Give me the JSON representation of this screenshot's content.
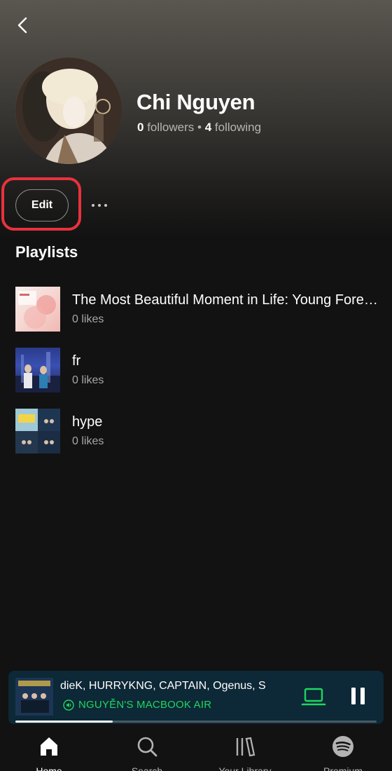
{
  "profile": {
    "name": "Chi Nguyen",
    "followers_count": "0",
    "followers_label": "followers",
    "separator": "•",
    "following_count": "4",
    "following_label": "following",
    "avatar_icon": "profile-avatar-image"
  },
  "actions": {
    "edit_label": "Edit",
    "more_icon": "more-horizontal-icon",
    "back_icon": "chevron-left-icon"
  },
  "playlists_section": {
    "title": "Playlists",
    "items": [
      {
        "title": "The Most Beautiful Moment in Life: Young Forever",
        "likes": "0 likes"
      },
      {
        "title": "fr",
        "likes": "0 likes"
      },
      {
        "title": "hype",
        "likes": "0 likes"
      }
    ]
  },
  "now_playing": {
    "track_artists": "dieK, HURRYKNG, CAPTAIN, Ogenus, S",
    "device": "NGUYỄN'S MACBOOK AIR",
    "device_icon": "speaker-icon",
    "connect_icon": "laptop-icon",
    "pause_icon": "pause-icon",
    "progress": 0.27
  },
  "nav": {
    "items": [
      {
        "label": "Home",
        "icon": "home-icon"
      },
      {
        "label": "Search",
        "icon": "search-icon"
      },
      {
        "label": "Your Library",
        "icon": "library-icon"
      },
      {
        "label": "Premium",
        "icon": "spotify-logo-icon"
      }
    ]
  },
  "colors": {
    "accent_green": "#1ed760",
    "highlight_red": "#e8323c",
    "background": "#121212"
  }
}
